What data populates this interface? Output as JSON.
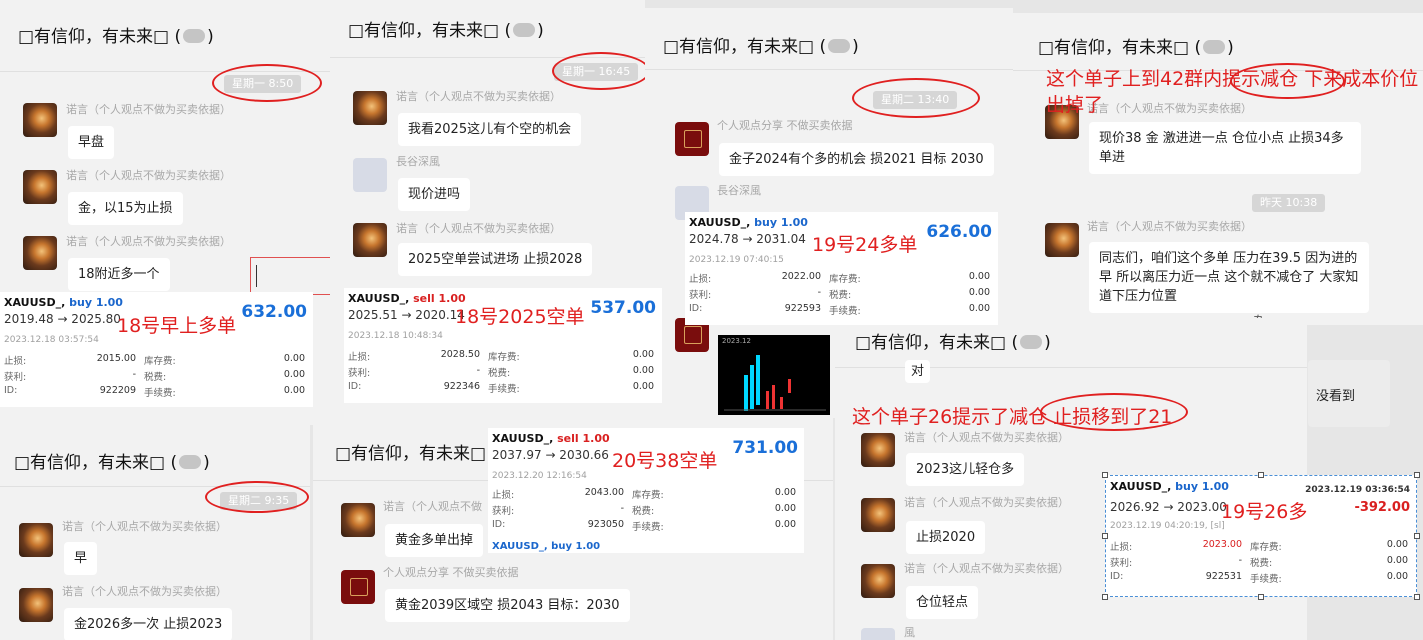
{
  "chat_title": "□有信仰，有未来□",
  "header_suffix": ")",
  "header_prefix": "(",
  "panel1": {
    "timestamp": "星期一 8:50",
    "messages": [
      {
        "name": "诺言（个人观点不做为买卖依据）",
        "text": "早盘"
      },
      {
        "name": "诺言（个人观点不做为买卖依据）",
        "text": "金，以15为止损"
      },
      {
        "name": "诺言（个人观点不做为买卖依据）",
        "text": "18附近多一个"
      }
    ],
    "annotation": "18号早上多单"
  },
  "panel2": {
    "timestamp": "星期一 16:45",
    "messages": [
      {
        "name": "诺言（个人观点不做为买卖依据）",
        "text": "我看2025这儿有个空的机会"
      },
      {
        "name": "長谷深風",
        "text": "现价进吗"
      },
      {
        "name": "诺言（个人观点不做为买卖依据）",
        "text": "2025空单尝试进场 止损2028"
      }
    ],
    "annotation": "18号2025空单"
  },
  "panel3": {
    "timestamp": "星期二 13:40",
    "messages": [
      {
        "name": "个人观点分享 不做买卖依据",
        "text": "金子2024有个多的机会 损2021 目标 2030"
      },
      {
        "name": "長谷深風",
        "text": ""
      }
    ],
    "annotation": "19号24多单",
    "chart_label": "2023.12"
  },
  "panel4": {
    "annotation": "这个单子上到42群内提示减仓  下来成本价位出掉了",
    "messages": [
      {
        "name": "诺言（个人观点不做为买卖依据）",
        "text": "现价38   金  激进进一点    仓位小点  止损34多单进"
      },
      {
        "name": "诺言（个人观点不做为买卖依据）",
        "text": "同志们，咱们这个多单 压力在39.5     因为进的早 所以离压力近一点  这个就不减仓了 大家知道下压力位置"
      }
    ],
    "timestamp": "昨天 10:38",
    "side_text": "没看到",
    "pin": "卆",
    "minimize": "—"
  },
  "panel5": {
    "timestamp": "星期二 9:35",
    "messages": [
      {
        "name": "诺言（个人观点不做为买卖依据）",
        "text": "早"
      },
      {
        "name": "诺言（个人观点不做为买卖依据）",
        "text": "金2026多一次  止损2023"
      }
    ]
  },
  "panel6": {
    "messages": [
      {
        "name": "诺言（个人观点不做",
        "text": "黄金多单出掉"
      },
      {
        "name": "个人观点分享 不做买卖依据",
        "text": "黄金2039区域空 损2043 目标：2030"
      }
    ],
    "annotation": "20号38空单"
  },
  "panel7": {
    "annotation": "这个单子26提示了减仓  止损移到了21",
    "messages": [
      {
        "name": "诺言（个人观点不做为买卖依据）",
        "text": "2023这儿轻仓多"
      },
      {
        "name": "诺言（个人观点不做为买卖依据）",
        "text": "止损2020"
      },
      {
        "name": "诺言（个人观点不做为买卖依据）",
        "text": "仓位轻点"
      }
    ],
    "partial": "对",
    "annotation2": "19号26多",
    "bottom_name": "風"
  },
  "card_labels": {
    "sl": "止损:",
    "tp": "获利:",
    "id": "ID:",
    "swap": "库存费:",
    "tax": "税费:",
    "fee": "手续费:"
  },
  "cards": [
    {
      "symbol": "XAUUSD_,",
      "side": "buy 1.00",
      "side_type": "buy",
      "prices": "2019.48 → 2025.80",
      "profit": "632.00",
      "date": "2023.12.18 03:57:54",
      "sl": "2015.00",
      "tp": "-",
      "id": "922209",
      "swap": "0.00",
      "tax": "0.00",
      "fee": "0.00"
    },
    {
      "symbol": "XAUUSD_,",
      "side": "sell 1.00",
      "side_type": "sell",
      "prices": "2025.51 → 2020.14",
      "profit": "537.00",
      "date": "2023.12.18 10:48:34",
      "sl": "2028.50",
      "tp": "-",
      "id": "922346",
      "swap": "0.00",
      "tax": "0.00",
      "fee": "0.00"
    },
    {
      "symbol": "XAUUSD_,",
      "side": "buy 1.00",
      "side_type": "buy",
      "prices": "2024.78 → 2031.04",
      "profit": "626.00",
      "date": "2023.12.19 07:40:15",
      "sl": "2022.00",
      "tp": "-",
      "id": "922593",
      "swap": "0.00",
      "tax": "0.00",
      "fee": "0.00"
    },
    {
      "symbol": "XAUUSD_,",
      "side": "sell 1.00",
      "side_type": "sell",
      "prices": "2037.97 → 2030.66",
      "profit": "731.00",
      "date": "2023.12.20 12:16:54",
      "sl": "2043.00",
      "tp": "-",
      "id": "923050",
      "swap": "0.00",
      "tax": "0.00",
      "fee": "0.00",
      "next_peek": "XAUUSD_,   buy 1.00"
    },
    {
      "symbol": "XAUUSD_,",
      "side": "buy 1.00",
      "side_type": "buy",
      "prices": "2026.92 → 2023.00",
      "profit": "-392.00",
      "date": "2023.12.19 04:20:19, [sl]",
      "close_time": "2023.12.19 03:36:54",
      "sl": "2023.00",
      "tp": "-",
      "id": "922531",
      "swap": "0.00",
      "tax": "0.00",
      "fee": "0.00"
    }
  ]
}
